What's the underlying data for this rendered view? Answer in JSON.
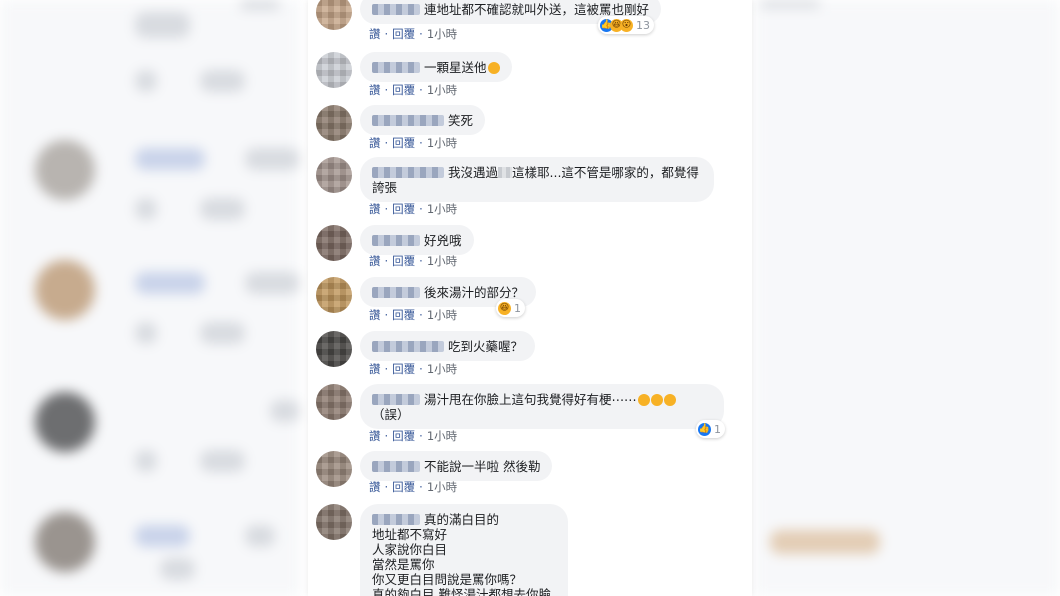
{
  "actions": {
    "like": "讚",
    "reply": "回覆",
    "time": "1小時"
  },
  "comments": [
    {
      "text": "連地址都不確認就叫外送，這被罵也剛好",
      "reactions": "13"
    },
    {
      "text": "一顆星送他"
    },
    {
      "text": "笑死"
    },
    {
      "text_a": "我沒遇過",
      "text_b": "這樣耶...這不管是哪家的，都覺得",
      "text_c": "誇張"
    },
    {
      "text": "好兇哦"
    },
    {
      "text": "後來湯汁的部分？",
      "reactions": "1"
    },
    {
      "text": "吃到火藥喔？"
    },
    {
      "text": "湯汁甩在你臉上這句我覺得好有梗⋯⋯",
      "text_b": "（誤）",
      "reactions": "1"
    },
    {
      "text": "不能說一半啦 然後勒"
    },
    {
      "lines": [
        "真的滿白目的",
        "地址都不寫好",
        "人家說你白目",
        "當然是罵你",
        "你又更白目問說是罵你嗎？",
        "真的夠白目 難怪湯汁都想去你臉上"
      ]
    }
  ],
  "colors": {
    "link": "#385898",
    "bubble": "#f2f3f5",
    "like": "#1877f2",
    "haha": "#f7b125"
  },
  "icons": {
    "like": "like-icon",
    "haha": "haha-icon",
    "wow": "wow-icon"
  }
}
